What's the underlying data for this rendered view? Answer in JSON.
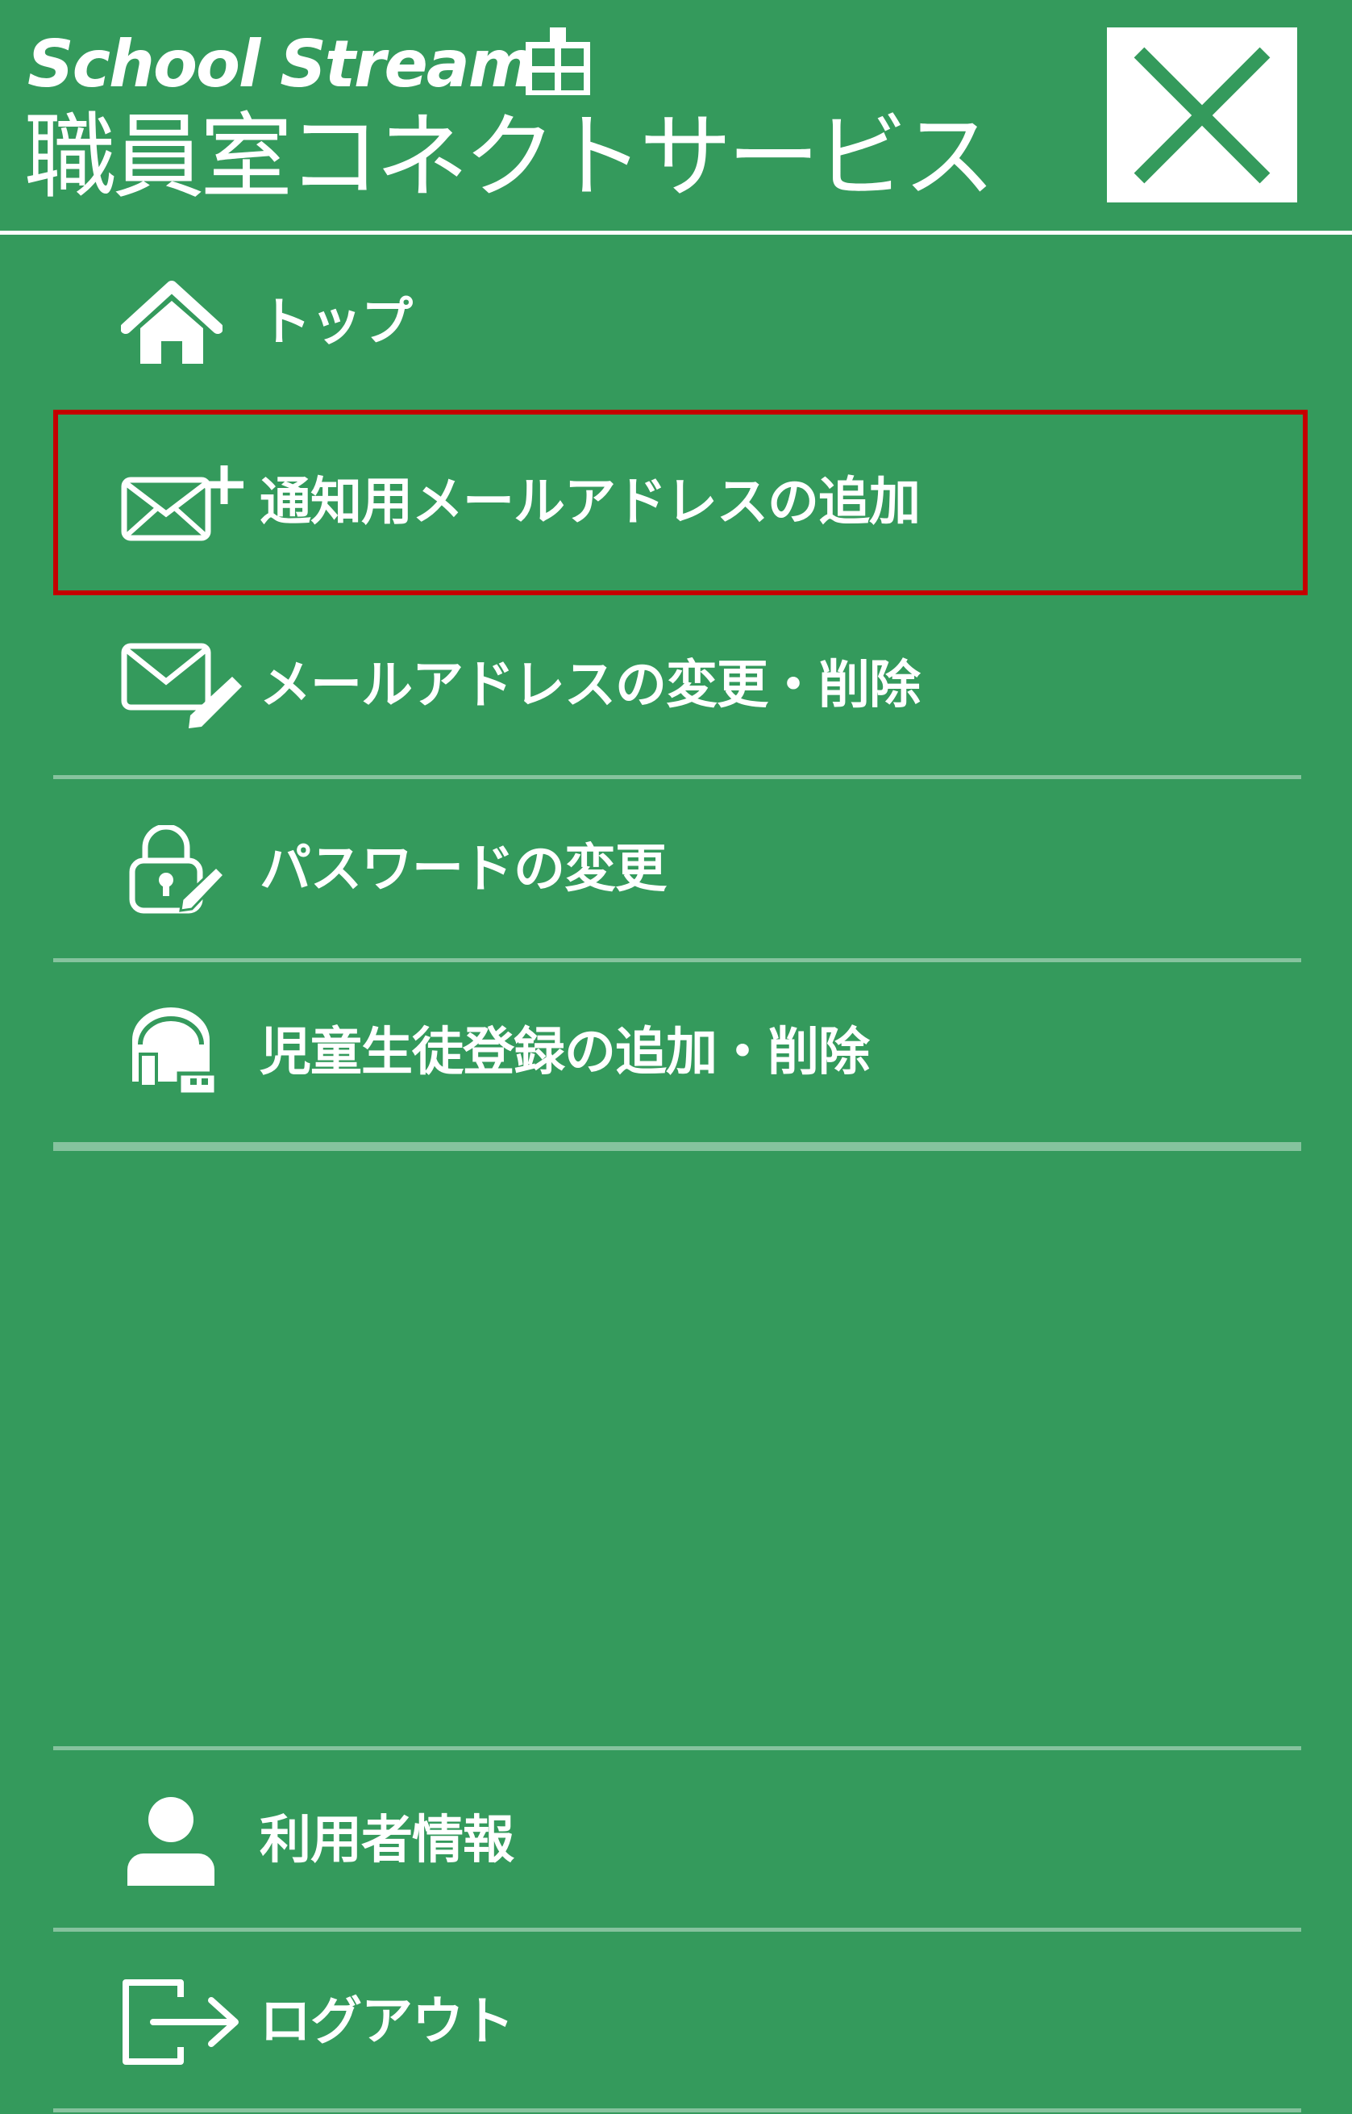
{
  "header": {
    "brand_en": "School Stream",
    "brand_ja": "職員室コネクトサービス"
  },
  "menu": {
    "top": "トップ",
    "add_email": "通知用メールアドレスの追加",
    "edit_email": "メールアドレスの変更・削除",
    "change_password": "パスワードの変更",
    "student_registration": "児童生徒登録の追加・削除",
    "user_info": "利用者情報",
    "logout": "ログアウト"
  },
  "colors": {
    "background": "#349a5c",
    "highlight_border": "#c40000",
    "separator": "#86c39e"
  },
  "icons": [
    "home-icon",
    "mail-plus-icon",
    "mail-edit-icon",
    "lock-edit-icon",
    "school-bag-icon",
    "user-icon",
    "logout-icon",
    "close-icon",
    "building-icon"
  ]
}
